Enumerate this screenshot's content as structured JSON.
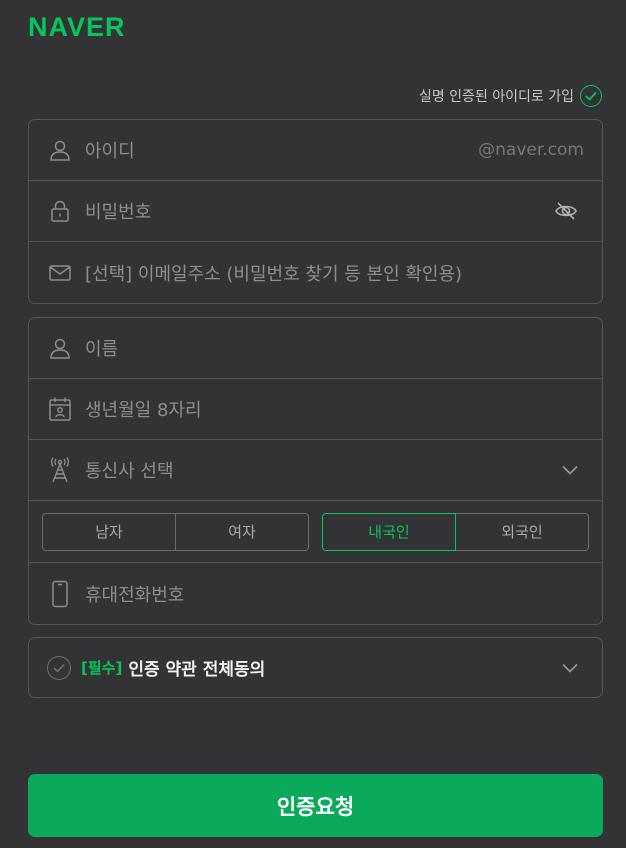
{
  "logo": "NAVER",
  "real_name_signup": "실명 인증된 아이디로 가입",
  "account": {
    "id_placeholder": "아이디",
    "id_suffix": "@naver.com",
    "password_placeholder": "비밀번호",
    "email_placeholder": "[선택] 이메일주소 (비밀번호 찾기 등 본인 확인용)"
  },
  "profile": {
    "name_placeholder": "이름",
    "birth_placeholder": "생년월일 8자리",
    "carrier_placeholder": "통신사 선택",
    "gender": [
      "남자",
      "여자"
    ],
    "nationality": [
      "내국인",
      "외국인"
    ],
    "nationality_selected": "내국인",
    "phone_placeholder": "휴대전화번호"
  },
  "agreement": {
    "required_tag": "[필수]",
    "label": "인증 약관 전체동의"
  },
  "submit_label": "인증요청",
  "colors": {
    "accent": "#03c75a",
    "background": "#333335",
    "button": "#0aa95b"
  },
  "icons": [
    "user-icon",
    "lock-icon",
    "eye-off-icon",
    "mail-icon",
    "calendar-icon",
    "antenna-icon",
    "chevron-down-icon",
    "phone-icon",
    "check-circle-icon"
  ]
}
